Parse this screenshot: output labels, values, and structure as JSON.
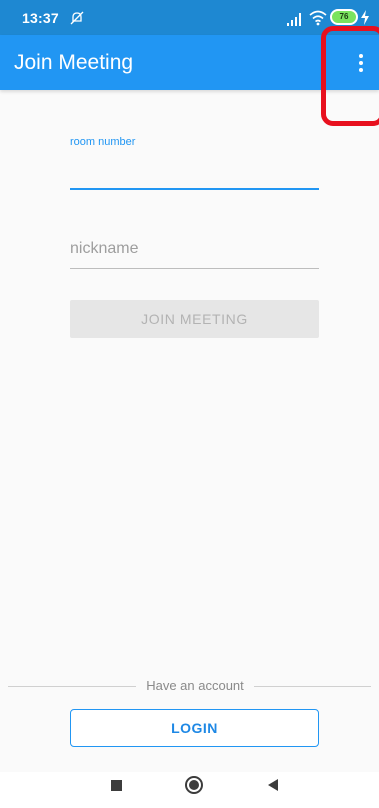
{
  "status_bar": {
    "time": "13:37",
    "battery_level": "76",
    "icons": [
      "mute-icon",
      "signal-icon",
      "wifi-icon",
      "battery-icon",
      "charging-icon"
    ]
  },
  "app_bar": {
    "title": "Join Meeting",
    "menu_icon": "more-vert-icon"
  },
  "form": {
    "room_number_label": "room number",
    "room_number_value": "",
    "nickname_placeholder": "nickname",
    "nickname_value": "",
    "join_button_label": "JOIN MEETING"
  },
  "account": {
    "prompt": "Have an account",
    "login_button_label": "LOGIN"
  },
  "nav_bar": {
    "icons": [
      "recents-icon",
      "home-icon",
      "back-icon"
    ]
  },
  "colors": {
    "primary": "#2196f3",
    "status_bar": "#1e88d2",
    "highlight": "#e8101e",
    "disabled_button": "#e6e6e6"
  }
}
